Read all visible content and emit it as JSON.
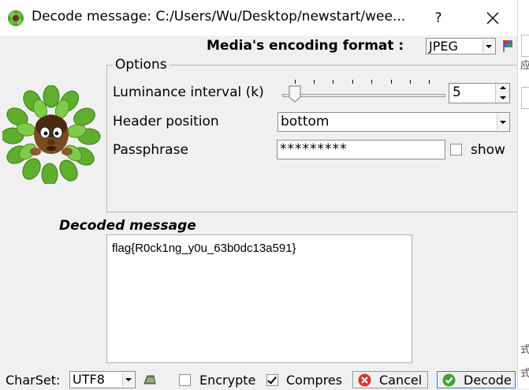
{
  "window": {
    "title": "Decode message: C:/Users/Wu/Desktop/newstart/wee...",
    "help_label": "?",
    "bg_fragments": [
      "应",
      "式",
      "式"
    ]
  },
  "encoding": {
    "label": "Media's encoding format :",
    "value": "JPEG"
  },
  "options": {
    "title": "Options",
    "luminance_label": "Luminance interval (k)",
    "luminance_value": "5",
    "header_label": "Header position",
    "header_value": "bottom",
    "passphrase_label": "Passphrase",
    "passphrase_value": "*********",
    "show_label": "show"
  },
  "decoded": {
    "title": "Decoded message",
    "text": "flag{R0ck1ng_y0u_63b0dc13a591}"
  },
  "bottom": {
    "charset_label": "CharSet:",
    "charset_value": "UTF8",
    "encrypted_label": "Encrypted",
    "compress_label": "Compres",
    "cancel_label": "Cancel",
    "decode_label": "Decode"
  },
  "colors": {
    "leaf_green": "#5fae2e",
    "cancel_red": "#d9342b",
    "decode_green": "#3fa33a",
    "focus_blue": "#3b7bd1"
  },
  "icons": [
    "app-leaf-icon",
    "close-icon",
    "encoding-flag-icon",
    "mascot-icon",
    "charset-icon",
    "cancel-icon",
    "decode-icon"
  ]
}
